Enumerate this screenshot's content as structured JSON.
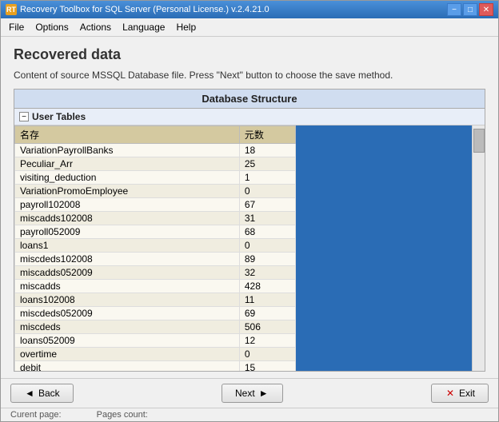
{
  "window": {
    "title": "Recovery Toolbox for SQL Server (Personal License.) v.2.4.21.0",
    "icon": "RT"
  },
  "title_controls": {
    "minimize": "−",
    "maximize": "□",
    "close": "✕"
  },
  "menu": {
    "items": [
      "File",
      "Options",
      "Actions",
      "Language",
      "Help"
    ]
  },
  "page": {
    "title": "Recovered data",
    "description": "Content of source MSSQL Database file. Press \"Next\" button to choose the save method."
  },
  "panel": {
    "header": "Database Structure"
  },
  "tree": {
    "node_label": "User Tables",
    "toggle": "−"
  },
  "table": {
    "columns": [
      "名存",
      "元数"
    ],
    "rows": [
      {
        "name": "VariationPayrollBanks",
        "count": "18",
        "selected": false
      },
      {
        "name": "Peculiar_Arr",
        "count": "25",
        "selected": false
      },
      {
        "name": "visiting_deduction",
        "count": "1",
        "selected": false
      },
      {
        "name": "VariationPromoEmployee",
        "count": "0",
        "selected": false
      },
      {
        "name": "payroll102008",
        "count": "67",
        "selected": false
      },
      {
        "name": "miscadds102008",
        "count": "31",
        "selected": false
      },
      {
        "name": "payroll052009",
        "count": "68",
        "selected": false
      },
      {
        "name": "loans1",
        "count": "0",
        "selected": false
      },
      {
        "name": "miscdeds102008",
        "count": "89",
        "selected": false
      },
      {
        "name": "miscadds052009",
        "count": "32",
        "selected": false
      },
      {
        "name": "miscadds",
        "count": "428",
        "selected": false
      },
      {
        "name": "loans102008",
        "count": "11",
        "selected": false
      },
      {
        "name": "miscdeds052009",
        "count": "69",
        "selected": false
      },
      {
        "name": "miscdeds",
        "count": "506",
        "selected": false
      },
      {
        "name": "loans052009",
        "count": "12",
        "selected": false
      },
      {
        "name": "overtime",
        "count": "0",
        "selected": false
      },
      {
        "name": "debit",
        "count": "15",
        "selected": false
      }
    ]
  },
  "buttons": {
    "back_label": "Back",
    "next_label": "Next",
    "exit_label": "Exit",
    "back_icon": "◄",
    "next_icon": "►",
    "exit_icon": "✕"
  },
  "status": {
    "current_page_label": "Curent page:",
    "current_page_value": "",
    "pages_count_label": "Pages count:",
    "pages_count_value": ""
  }
}
